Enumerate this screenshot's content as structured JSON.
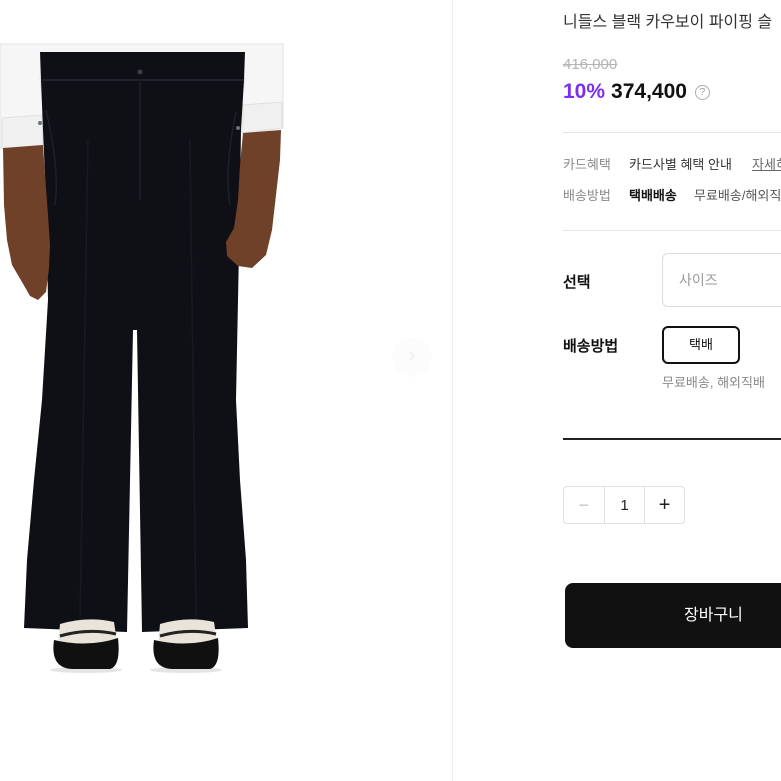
{
  "product": {
    "title": "니들스 블랙 카우보이 파이핑 슬",
    "original_price": "416,000",
    "discount_rate": "10%",
    "sale_price": "374,400",
    "price_info_icon": "question-circle-icon",
    "price_info_glyph": "?"
  },
  "benefits": {
    "card": {
      "label": "카드혜택",
      "text": "카드사별 혜택 안내",
      "link": "자세히"
    },
    "shipping": {
      "label": "배송방법",
      "method": "택배배송",
      "text": "무료배송/해외직"
    }
  },
  "options": {
    "select_label": "선택",
    "size_placeholder": "사이즈",
    "delivery_label": "배송방법",
    "delivery_choice": "택배",
    "delivery_note": "무료배송, 해외직배"
  },
  "quantity": {
    "minus": "−",
    "value": "1",
    "plus": "+"
  },
  "actions": {
    "cart": "장바구니"
  },
  "gallery": {
    "next_icon": "chevron-right-icon",
    "next_glyph": "›"
  },
  "colors": {
    "accent": "#7b2ff2",
    "button": "#111111",
    "text": "#222222",
    "muted": "#999999",
    "pants": "#0e1016",
    "skin": "#6f4128"
  }
}
